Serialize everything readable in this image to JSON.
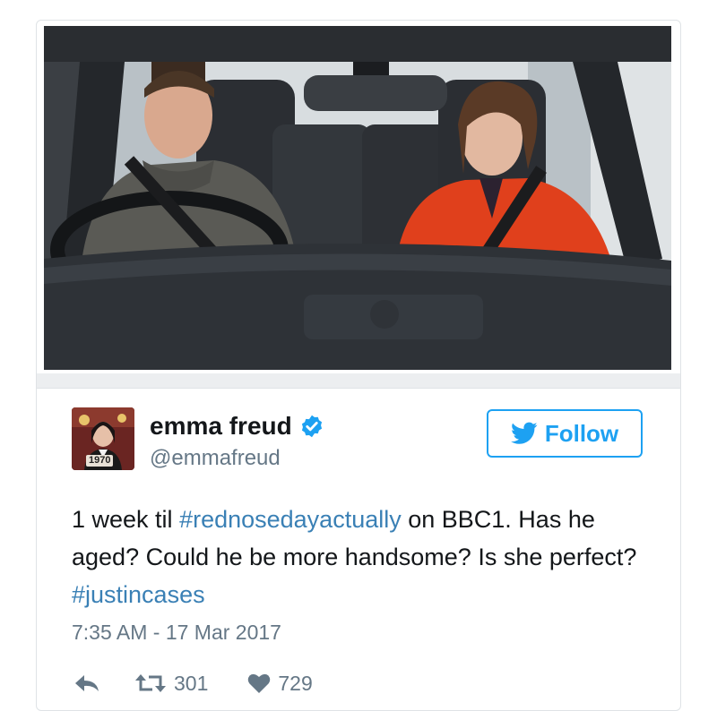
{
  "tweet": {
    "author": {
      "display_name": "emma freud",
      "handle": "@emmafreud",
      "verified": true,
      "avatar_badge": "1970"
    },
    "follow_label": "Follow",
    "text_segments": [
      "1 week til ",
      "#rednosedayactually",
      " on BBC1. Has he aged? Could he be more handsome? Is she perfect? ",
      "#justincases"
    ],
    "timestamp": "7:35 AM - 17 Mar 2017",
    "retweet_count": "301",
    "like_count": "729"
  },
  "icons": {
    "verified": "verified-badge-icon",
    "follow": "twitter-bird-icon",
    "reply": "reply-arrow-icon",
    "retweet": "retweet-icon",
    "like": "heart-icon"
  },
  "colors": {
    "accent": "#1da1f2",
    "hashtag": "#3a80b5",
    "muted": "#657786",
    "text": "#14171a",
    "jacket_red": "#e0401c"
  }
}
